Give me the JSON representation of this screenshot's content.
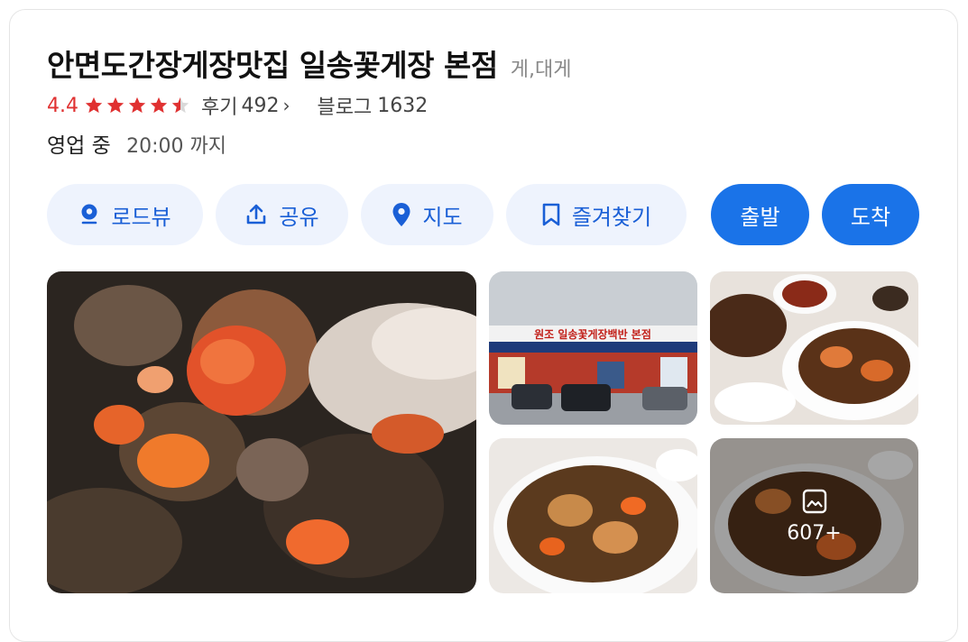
{
  "place": {
    "title": "안면도간장게장맛집 일송꽃게장 본점",
    "category": "게,대게"
  },
  "rating": {
    "score": "4.4",
    "stars_value": 4.4,
    "review_label": "후기",
    "review_count": "492",
    "review_chevron": "›",
    "blog_label": "블로그",
    "blog_count": "1632"
  },
  "hours": {
    "status": "영업 중",
    "until": "20:00 까지"
  },
  "actions": {
    "roadview": "로드뷰",
    "share": "공유",
    "map": "지도",
    "bookmark": "즐겨찾기",
    "depart": "출발",
    "arrive": "도착"
  },
  "photos": {
    "more_count": "607+",
    "sign_text": "원조 일송꽃게장백반 본점"
  },
  "colors": {
    "accent": "#1a73e8",
    "star": "#e03131",
    "button_bg": "#eef3fd"
  }
}
